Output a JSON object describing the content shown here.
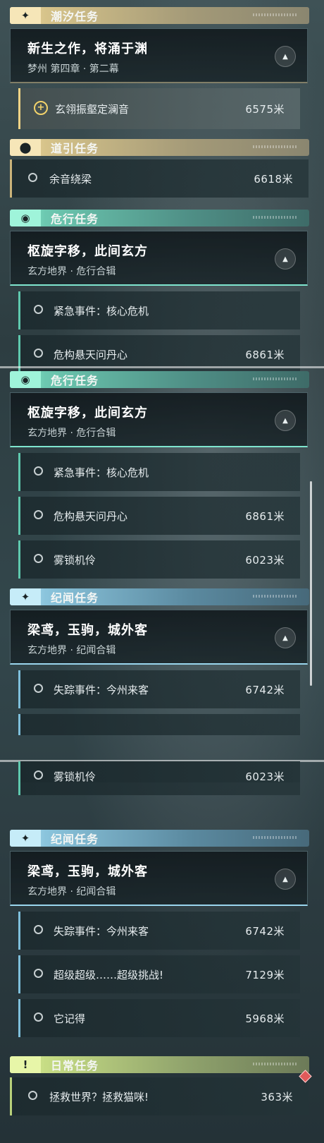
{
  "colors": {
    "accent_gold": "#f0d486",
    "accent_teal": "#5fc9ae",
    "accent_blue": "#7fc0dc",
    "accent_green": "#b8d07a",
    "badge_red": "#e05a5a"
  },
  "views": [
    {
      "tide": {
        "header": {
          "title": "潮汐任务",
          "icon": "sparkle-icon"
        },
        "chapter": {
          "title": "新生之作，将涌于渊",
          "subtitle": "梦州 第四章 · 第二幕"
        },
        "active_task": {
          "name": "玄翎振壑定澜音",
          "distance": "6575米"
        }
      },
      "guide": {
        "header": {
          "title": "道引任务",
          "icon": "location-pin-icon"
        },
        "task": {
          "name": "余音绕梁",
          "distance": "6618米"
        }
      },
      "danger": {
        "header": {
          "title": "危行任务",
          "icon": "danger-eye-icon"
        },
        "chapter": {
          "title": "枢旋字移，此间玄方",
          "subtitle": "玄方地界 · 危行合辑"
        },
        "tasks": [
          {
            "name": "紧急事件：核心危机",
            "distance": ""
          },
          {
            "name": "危构悬天问丹心",
            "distance": "6861米"
          }
        ]
      }
    },
    {
      "danger": {
        "header": {
          "title": "危行任务",
          "icon": "danger-eye-icon"
        },
        "chapter": {
          "title": "枢旋字移，此间玄方",
          "subtitle": "玄方地界 · 危行合辑"
        },
        "tasks": [
          {
            "name": "紧急事件：核心危机",
            "distance": ""
          },
          {
            "name": "危构悬天问丹心",
            "distance": "6861米"
          },
          {
            "name": "雾锁机伶",
            "distance": "6023米"
          }
        ]
      },
      "chronicle": {
        "header": {
          "title": "纪闻任务",
          "icon": "sparkle-icon"
        },
        "chapter": {
          "title": "梁鸢，玉驹，城外客",
          "subtitle": "玄方地界 · 纪闻合辑"
        },
        "tasks": [
          {
            "name": "失踪事件：今州来客",
            "distance": "6742米"
          }
        ]
      }
    },
    {
      "danger": {
        "tasks": [
          {
            "name": "雾锁机伶",
            "distance": "6023米"
          }
        ]
      },
      "chronicle": {
        "header": {
          "title": "纪闻任务",
          "icon": "sparkle-icon"
        },
        "chapter": {
          "title": "梁鸢，玉驹，城外客",
          "subtitle": "玄方地界 · 纪闻合辑"
        },
        "tasks": [
          {
            "name": "失踪事件：今州来客",
            "distance": "6742米"
          },
          {
            "name": "超级超级……超级挑战!",
            "distance": "7129米"
          },
          {
            "name": "它记得",
            "distance": "5968米"
          }
        ]
      },
      "daily": {
        "header": {
          "title": "日常任务",
          "icon": "exclamation-box-icon"
        },
        "task": {
          "name": "拯救世界？拯救猫咪!",
          "distance": "363米"
        }
      }
    }
  ]
}
